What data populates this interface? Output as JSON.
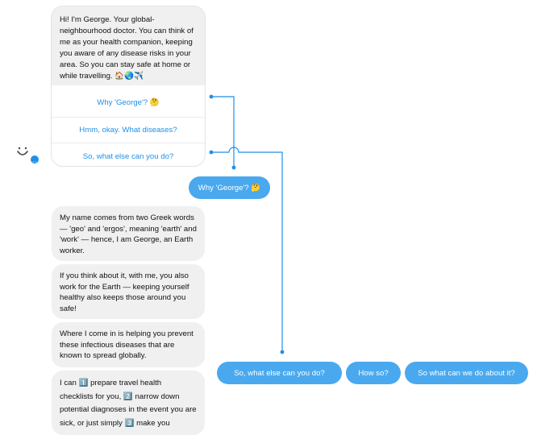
{
  "greeting": {
    "text": "Hi! I'm George. Your global-neighbourhood doctor. You can think of me as your health companion, keeping you aware of any disease risks in your area. So you can stay safe at home or while travelling. 🏠🌏✈️"
  },
  "quick_replies": [
    {
      "label": "Why 'George'? 🤔"
    },
    {
      "label": "Hmm, okay. What diseases?"
    },
    {
      "label": "So, what else can you do?"
    }
  ],
  "user_reply": {
    "label": "Why 'George'? 🤔"
  },
  "bot_messages": [
    {
      "text": "My name comes from two Greek words — 'geo' and 'ergos', meaning 'earth' and 'work' — hence, I am George, an Earth worker."
    },
    {
      "text": "If you think about it, with me, you also work for the Earth — keeping yourself healthy also keeps those around you safe!"
    },
    {
      "text": "Where I come in is helping you prevent these infectious diseases that are known to spread globally."
    },
    {
      "text": "I can 1️⃣ prepare travel health checklists for you, 2️⃣ narrow down potential diagnoses in the event you are sick, or just simply 3️⃣ make you"
    }
  ],
  "next_options": [
    {
      "label": "So, what else can you do?"
    },
    {
      "label": "How so?"
    },
    {
      "label": "So what can we do about it?"
    }
  ],
  "colors": {
    "accent": "#1f8fe8",
    "pill": "#4aa9ee",
    "bubble": "#f0f0f0"
  }
}
